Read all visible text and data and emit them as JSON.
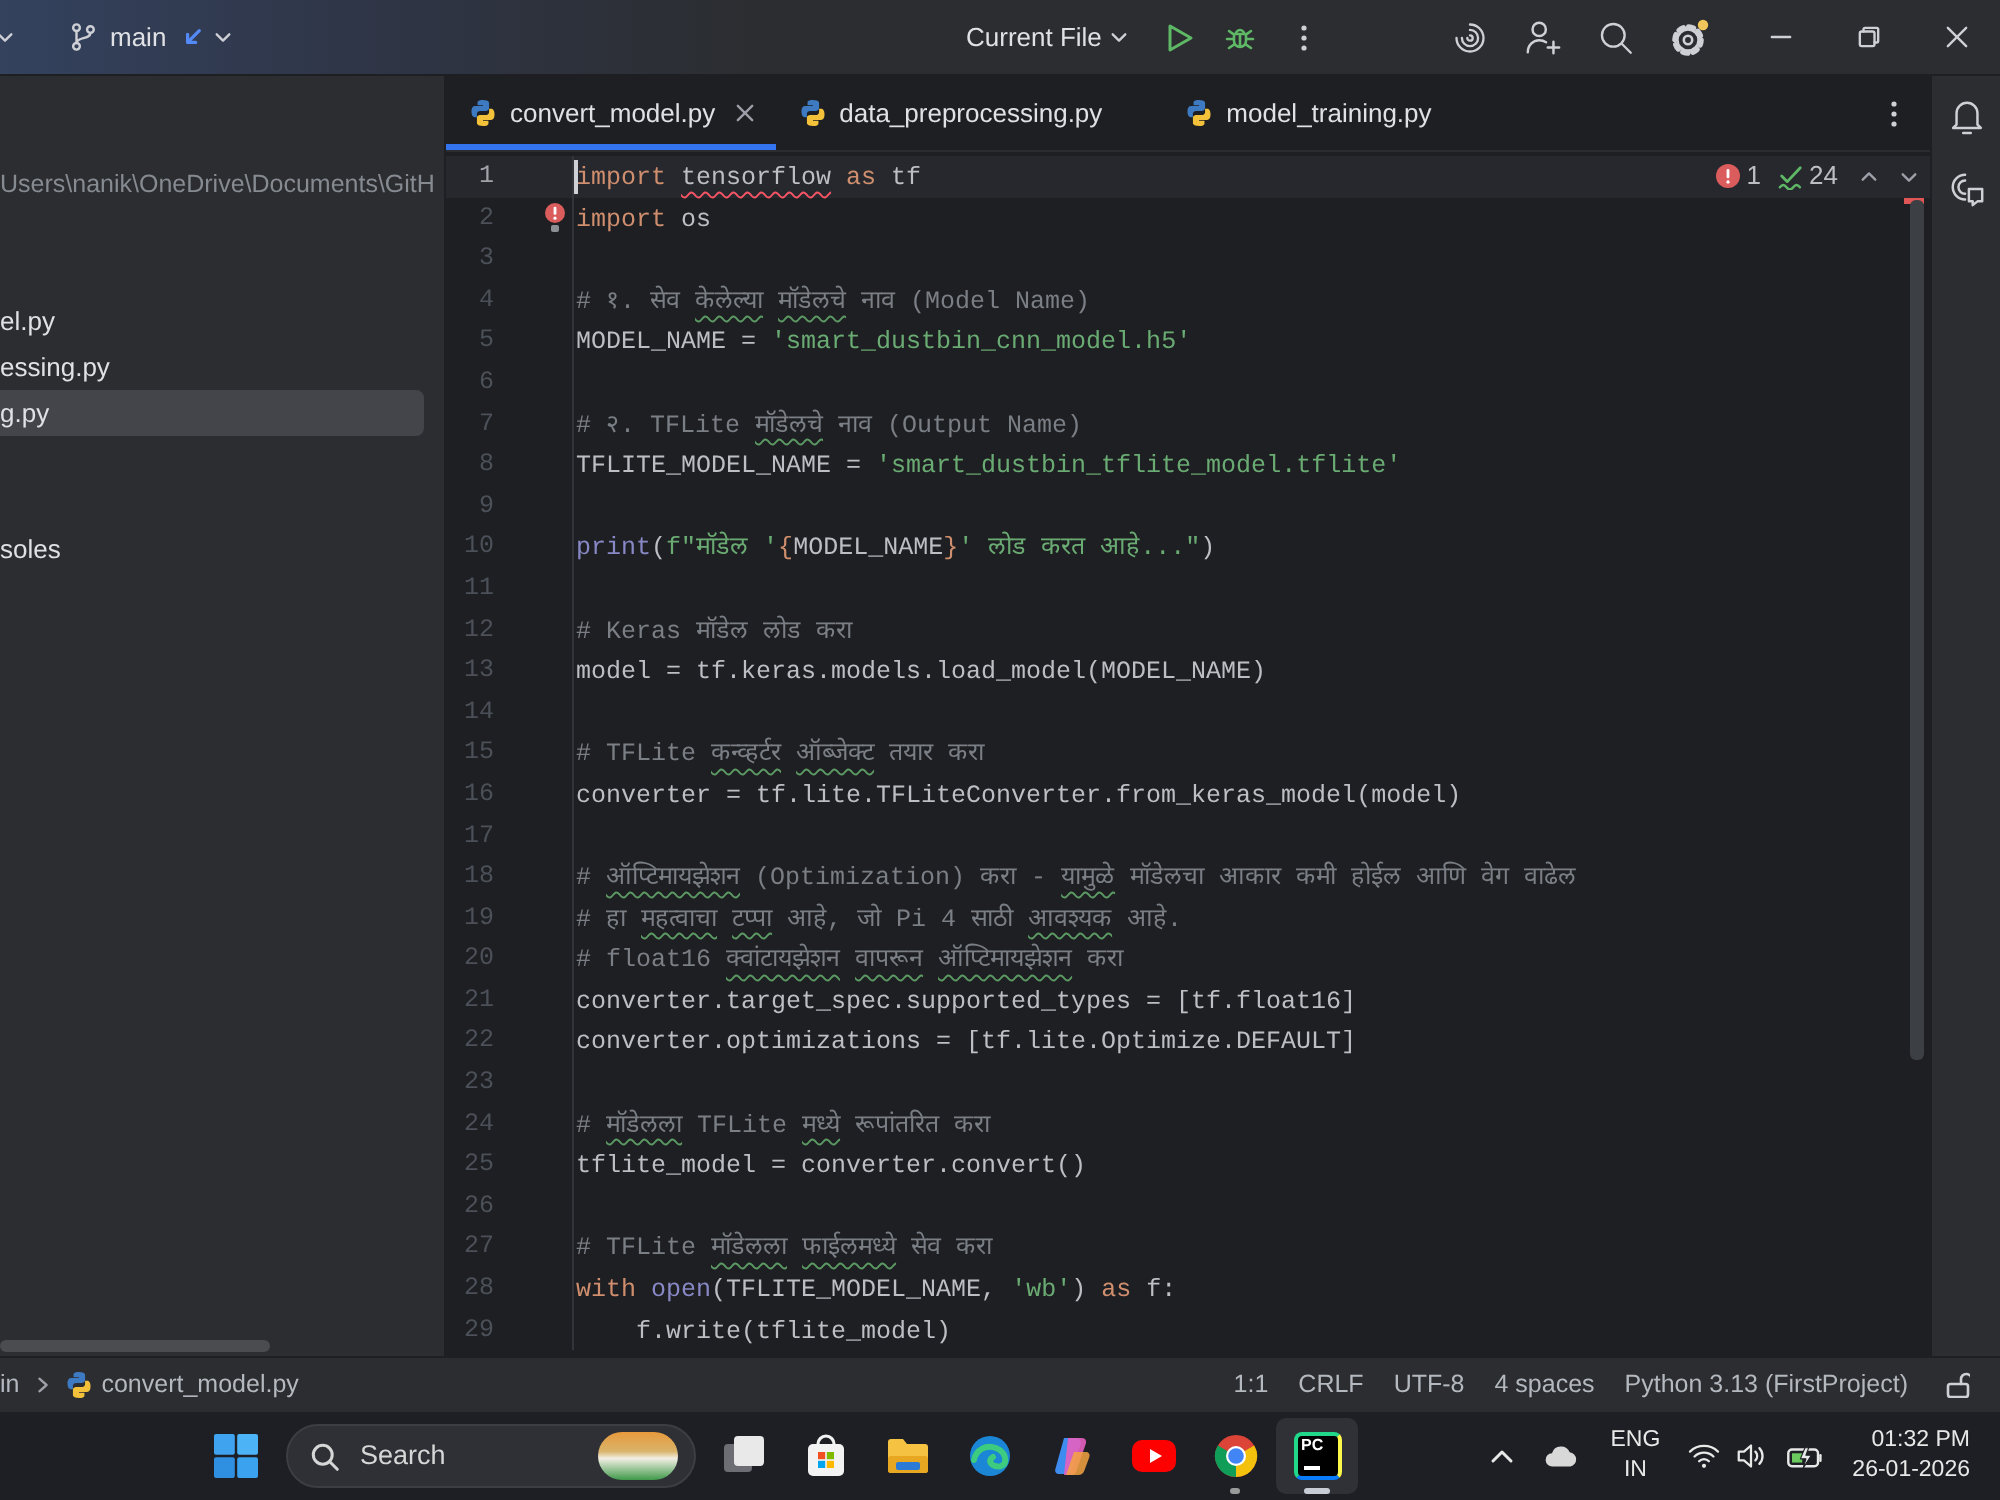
{
  "title_bar": {
    "branch": "main",
    "run_configuration": "Current File"
  },
  "project_panel": {
    "path": "Users\\nanik\\OneDrive\\Documents\\GitH",
    "items": [
      {
        "label": "el.py",
        "selected": false
      },
      {
        "label": "essing.py",
        "selected": false
      },
      {
        "label": "g.py",
        "selected": true
      },
      {
        "label": "soles",
        "selected": false
      }
    ]
  },
  "tabs": [
    {
      "label": "convert_model.py",
      "selected": true
    },
    {
      "label": "data_preprocessing.py",
      "selected": false
    },
    {
      "label": "model_training.py",
      "selected": false
    }
  ],
  "editor": {
    "inspections": {
      "errors": "1",
      "warnings": "24"
    },
    "lines": [
      {
        "number": "1",
        "current": true,
        "bulb": false,
        "tokens": [
          {
            "text": "import ",
            "kind": "keyword"
          },
          {
            "text": "tensorflow",
            "kind": "unresolved"
          },
          {
            "text": " as",
            "kind": "keyword"
          },
          {
            "text": " tf",
            "kind": "text"
          }
        ]
      },
      {
        "number": "2",
        "current": false,
        "bulb": true,
        "tokens": [
          {
            "text": "import",
            "kind": "keyword"
          },
          {
            "text": " os",
            "kind": "text"
          }
        ]
      },
      {
        "number": "3",
        "current": false,
        "bulb": false
      },
      {
        "number": "4",
        "current": false,
        "bulb": false,
        "tokens": [
          {
            "text": "# १. सेव ",
            "kind": "comment"
          },
          {
            "text": "केलेल्या ",
            "kind": "typo"
          },
          {
            "text": "मॉडेलचे",
            "kind": "typo"
          },
          {
            "text": " नाव (Model Name)",
            "kind": "comment"
          }
        ]
      },
      {
        "number": "5",
        "current": false,
        "bulb": false,
        "tokens": [
          {
            "text": "MODEL_NAME = ",
            "kind": "text"
          },
          {
            "text": "'smart_dustbin_cnn_model.h5'",
            "kind": "string"
          }
        ]
      },
      {
        "number": "6",
        "current": false,
        "bulb": false
      },
      {
        "number": "7",
        "current": false,
        "bulb": false,
        "tokens": [
          {
            "text": "# २. TFLite ",
            "kind": "comment"
          },
          {
            "text": "मॉडेलचे",
            "kind": "typo"
          },
          {
            "text": " नाव (Output Name)",
            "kind": "comment"
          }
        ]
      },
      {
        "number": "8",
        "current": false,
        "bulb": false,
        "tokens": [
          {
            "text": "TFLITE_MODEL_NAME = ",
            "kind": "text"
          },
          {
            "text": "'smart_dustbin_tflite_model.tflite'",
            "kind": "string"
          }
        ]
      },
      {
        "number": "9",
        "current": false,
        "bulb": false
      },
      {
        "number": "10",
        "current": false,
        "bulb": false,
        "tokens": [
          {
            "text": "print",
            "kind": "builtin"
          },
          {
            "text": "(",
            "kind": "text"
          },
          {
            "text": "f\"मॉडेल '",
            "kind": "string"
          },
          {
            "text": "{",
            "kind": "interp"
          },
          {
            "text": "MODEL_NAME",
            "kind": "text"
          },
          {
            "text": "}",
            "kind": "interp"
          },
          {
            "text": "' लोड करत आहे...\"",
            "kind": "string"
          },
          {
            "text": ")",
            "kind": "text"
          }
        ]
      },
      {
        "number": "11",
        "current": false,
        "bulb": false
      },
      {
        "number": "12",
        "current": false,
        "bulb": false,
        "tokens": [
          {
            "text": "# Keras मॉडेल लोड करा",
            "kind": "comment"
          }
        ]
      },
      {
        "number": "13",
        "current": false,
        "bulb": false,
        "tokens": [
          {
            "text": "model = tf.keras.models.load_model(MODEL_NAME)",
            "kind": "text"
          }
        ]
      },
      {
        "number": "14",
        "current": false,
        "bulb": false
      },
      {
        "number": "15",
        "current": false,
        "bulb": false,
        "tokens": [
          {
            "text": "# TFLite ",
            "kind": "comment"
          },
          {
            "text": "कन्व्हर्टर ",
            "kind": "typo"
          },
          {
            "text": "ऑब्जेक्ट",
            "kind": "typo"
          },
          {
            "text": " तयार करा",
            "kind": "comment"
          }
        ]
      },
      {
        "number": "16",
        "current": false,
        "bulb": false,
        "tokens": [
          {
            "text": "converter = tf.lite.TFLiteConverter.from_keras_model(model)",
            "kind": "text"
          }
        ]
      },
      {
        "number": "17",
        "current": false,
        "bulb": false
      },
      {
        "number": "18",
        "current": false,
        "bulb": false,
        "tokens": [
          {
            "text": "# ",
            "kind": "comment"
          },
          {
            "text": "ऑप्टिमायझेशन",
            "kind": "typo"
          },
          {
            "text": " (Optimization) करा - ",
            "kind": "comment"
          },
          {
            "text": "यामुळे",
            "kind": "typo"
          },
          {
            "text": " मॉडेलचा आकार कमी होईल आणि वेग वाढेल",
            "kind": "comment"
          }
        ]
      },
      {
        "number": "19",
        "current": false,
        "bulb": false,
        "tokens": [
          {
            "text": "# हा ",
            "kind": "comment"
          },
          {
            "text": "महत्वाचा ",
            "kind": "typo"
          },
          {
            "text": "टप्पा",
            "kind": "typo"
          },
          {
            "text": " आहे, जो Pi 4 साठी ",
            "kind": "comment"
          },
          {
            "text": "आवश्यक",
            "kind": "typo"
          },
          {
            "text": " आहे.",
            "kind": "comment"
          }
        ]
      },
      {
        "number": "20",
        "current": false,
        "bulb": false,
        "tokens": [
          {
            "text": "# float16 ",
            "kind": "comment"
          },
          {
            "text": "क्वांटायझेशन ",
            "kind": "typo"
          },
          {
            "text": "वापरून ",
            "kind": "typo"
          },
          {
            "text": "ऑप्टिमायझेशन",
            "kind": "typo"
          },
          {
            "text": " करा",
            "kind": "comment"
          }
        ]
      },
      {
        "number": "21",
        "current": false,
        "bulb": false,
        "tokens": [
          {
            "text": "converter.target_spec.supported_types = [tf.float16]",
            "kind": "text"
          }
        ]
      },
      {
        "number": "22",
        "current": false,
        "bulb": false,
        "tokens": [
          {
            "text": "converter.optimizations = [tf.lite.Optimize.DEFAULT]",
            "kind": "text"
          }
        ]
      },
      {
        "number": "23",
        "current": false,
        "bulb": false
      },
      {
        "number": "24",
        "current": false,
        "bulb": false,
        "tokens": [
          {
            "text": "# ",
            "kind": "comment"
          },
          {
            "text": "मॉडेलला",
            "kind": "typo"
          },
          {
            "text": " TFLite ",
            "kind": "comment"
          },
          {
            "text": "मध्ये",
            "kind": "typo"
          },
          {
            "text": " रूपांतरित करा",
            "kind": "comment"
          }
        ]
      },
      {
        "number": "25",
        "current": false,
        "bulb": false,
        "tokens": [
          {
            "text": "tflite_model = converter.convert()",
            "kind": "text"
          }
        ]
      },
      {
        "number": "26",
        "current": false,
        "bulb": false
      },
      {
        "number": "27",
        "current": false,
        "bulb": false,
        "tokens": [
          {
            "text": "# TFLite ",
            "kind": "comment"
          },
          {
            "text": "मॉडेलला ",
            "kind": "typo"
          },
          {
            "text": "फाईलमध्ये",
            "kind": "typo"
          },
          {
            "text": " सेव करा",
            "kind": "comment"
          }
        ]
      },
      {
        "number": "28",
        "current": false,
        "bulb": false,
        "tokens": [
          {
            "text": "with ",
            "kind": "keyword"
          },
          {
            "text": "open",
            "kind": "builtin"
          },
          {
            "text": "(TFLITE_MODEL_NAME, ",
            "kind": "text"
          },
          {
            "text": "'wb'",
            "kind": "string"
          },
          {
            "text": ") ",
            "kind": "text"
          },
          {
            "text": "as",
            "kind": "keyword"
          },
          {
            "text": " f:",
            "kind": "text"
          }
        ]
      },
      {
        "number": "29",
        "current": false,
        "bulb": false,
        "tokens": [
          {
            "text": "    f.write(tflite_model)",
            "kind": "text"
          }
        ]
      }
    ]
  },
  "status_bar": {
    "breadcrumbs": [
      {
        "label": "in",
        "kind": "folder"
      },
      {
        "label": "convert_model.py",
        "kind": "file"
      }
    ],
    "caret_position": "1:1",
    "line_separator": "CRLF",
    "encoding": "UTF-8",
    "indent": "4 spaces",
    "interpreter": "Python 3.13 (FirstProject)"
  },
  "taskbar": {
    "search": {
      "label": "Search"
    },
    "apps": [
      {
        "kind": "stack",
        "running": false,
        "active": false
      },
      {
        "kind": "bag",
        "running": false,
        "active": false
      },
      {
        "kind": "folder",
        "running": false,
        "active": false
      },
      {
        "kind": "wave",
        "running": false,
        "active": false
      },
      {
        "kind": "petals",
        "running": false,
        "active": false
      },
      {
        "kind": "play",
        "running": false,
        "active": false
      },
      {
        "kind": "ring",
        "running": true,
        "active": false
      },
      {
        "kind": "ide",
        "running": true,
        "active": true,
        "logo_text": "PC"
      }
    ],
    "language": "ENG",
    "region": "IN",
    "time": "01:32 PM",
    "date": "26-01-2026"
  }
}
